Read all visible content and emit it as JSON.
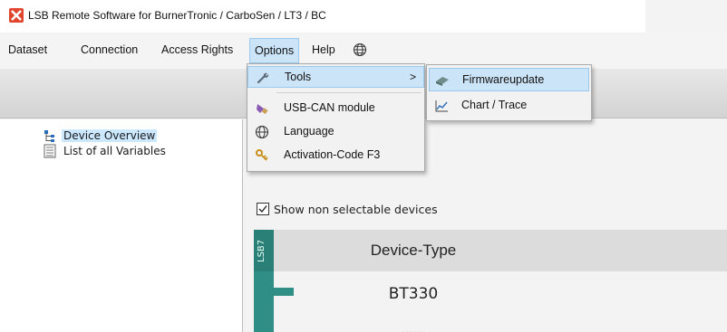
{
  "window": {
    "title": "LSB Remote Software for BurnerTronic / CarboSen / LT3 / BC"
  },
  "menubar": {
    "items": [
      "Dataset",
      "Connection",
      "Access Rights",
      "Options",
      "Help"
    ],
    "open_item": "Options"
  },
  "options_menu": {
    "items": [
      {
        "label": "Tools",
        "icon": "wrench-icon",
        "has_submenu": true,
        "highlighted": true
      },
      {
        "label": "USB-CAN module",
        "icon": "usb-can-icon"
      },
      {
        "label": "Language",
        "icon": "globe-icon"
      },
      {
        "label": "Activation-Code F3",
        "icon": "key-icon"
      }
    ],
    "submenu_arrow": ">"
  },
  "tools_submenu": {
    "items": [
      {
        "label": "Firmwareupdate",
        "icon": "firmware-icon",
        "highlighted": true
      },
      {
        "label": "Chart / Trace",
        "icon": "chart-icon"
      }
    ]
  },
  "tree": {
    "items": [
      {
        "label": "Device Overview",
        "icon": "tree-icon",
        "selected": true
      },
      {
        "label": "List of all Variables",
        "icon": "list-icon"
      }
    ]
  },
  "device_panel": {
    "show_non_selectable_label": "Show non selectable devices",
    "show_non_selectable_checked": true,
    "strip_label": "LSB7",
    "header_label": "Device-Type",
    "device_type_value": "BT330",
    "faded_value": "……"
  },
  "colors": {
    "menu_highlight": "#cce4f7",
    "menu_highlight_border": "#99c9ef",
    "device_strip": "#2f8f86",
    "app_icon": "#e0462e"
  }
}
